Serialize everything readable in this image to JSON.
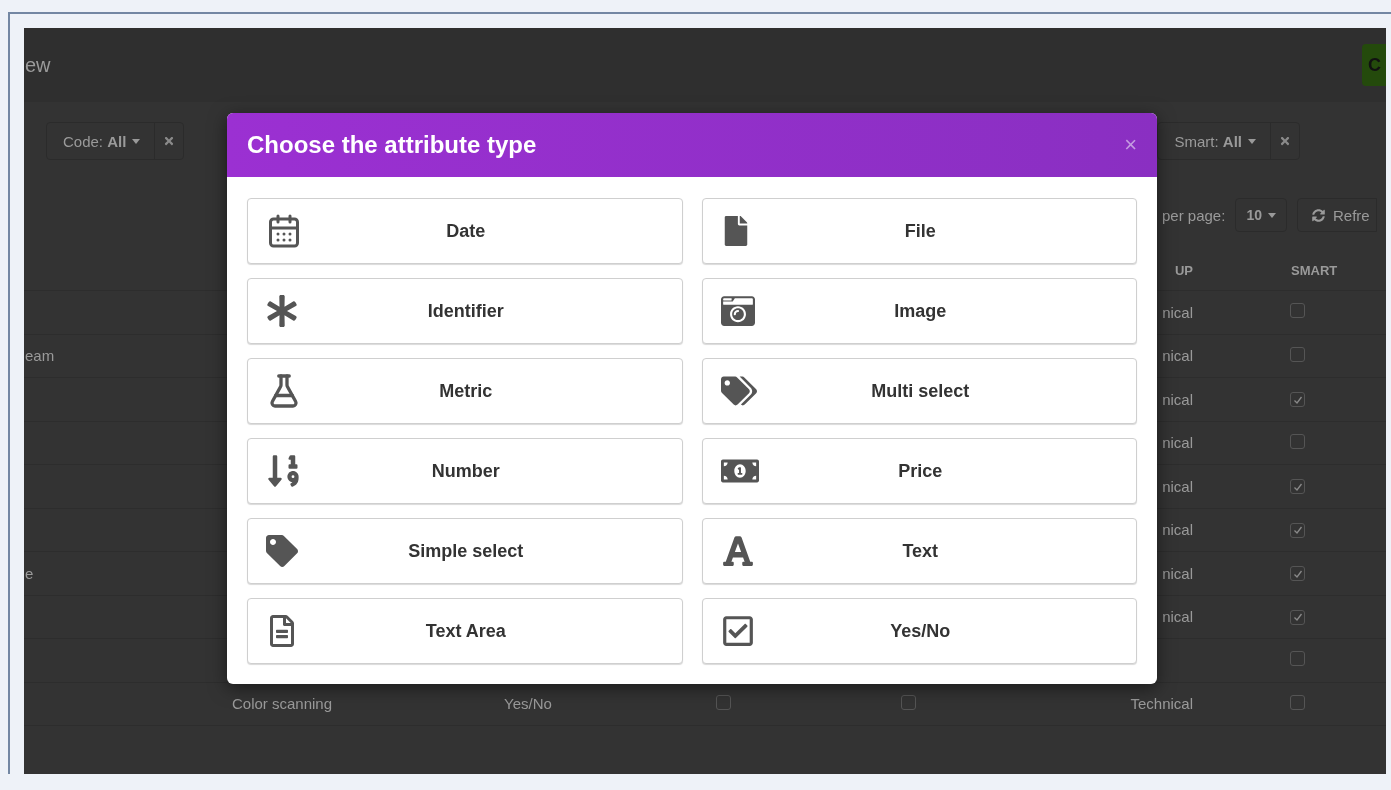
{
  "page": {
    "title": "ew",
    "primary_button": "C"
  },
  "filters": [
    {
      "label": "Code: **All**"
    },
    {
      "label": "Smart: **All**"
    }
  ],
  "pagination": {
    "label": "per page:",
    "per_page": "10",
    "refresh": "Refre"
  },
  "table": {
    "columns": {
      "group": "UP",
      "smart": "SMART"
    },
    "rows": [
      {
        "column_1": "",
        "label": "",
        "type": "",
        "group": "nical",
        "checks": [],
        "smart": false
      },
      {
        "column_1": "eam",
        "label": "",
        "type": "",
        "group": "nical",
        "checks": [],
        "smart": false
      },
      {
        "column_1": "",
        "label": "",
        "type": "",
        "group": "nical",
        "checks": [],
        "smart": true
      },
      {
        "column_1": "",
        "label": "",
        "type": "",
        "group": "nical",
        "checks": [],
        "smart": false
      },
      {
        "column_1": "",
        "label": "",
        "type": "",
        "group": "nical",
        "checks": [],
        "smart": true
      },
      {
        "column_1": "",
        "label": "",
        "type": "",
        "group": "nical",
        "checks": [],
        "smart": true
      },
      {
        "column_1": "e",
        "label": "",
        "type": "",
        "group": "nical",
        "checks": [],
        "smart": true
      },
      {
        "column_1": "",
        "label": "",
        "type": "",
        "group": "nical",
        "checks": [],
        "smart": true
      },
      {
        "column_1": "",
        "label": "",
        "type": "",
        "group": "",
        "checks": [],
        "smart": false
      },
      {
        "column_1": "",
        "label": "Color scanning",
        "type": "Yes/No",
        "group": "Technical",
        "checks": [
          false,
          false
        ],
        "smart": false
      }
    ]
  },
  "modal": {
    "title": "Choose the attribute type",
    "close": "×",
    "options": [
      {
        "label": "Date"
      },
      {
        "label": "File"
      },
      {
        "label": "Identifier"
      },
      {
        "label": "Image"
      },
      {
        "label": "Metric"
      },
      {
        "label": "Multi select"
      },
      {
        "label": "Number"
      },
      {
        "label": "Price"
      },
      {
        "label": "Simple select"
      },
      {
        "label": "Text"
      },
      {
        "label": "Text Area"
      },
      {
        "label": "Yes/No"
      }
    ]
  }
}
